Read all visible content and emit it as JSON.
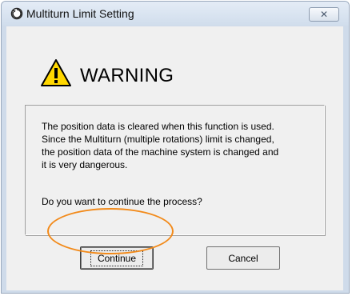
{
  "window": {
    "title": "Multiturn Limit Setting",
    "close_icon": "close-icon",
    "app_icon": "rotation-icon"
  },
  "dialog": {
    "warning_icon": "warning-triangle-icon",
    "warning_text": "WARNING",
    "message_lines": [
      "The position data is cleared when this function is used.",
      "Since the Multiturn (multiple rotations) limit is changed,",
      "the position data of the machine system is changed and",
      "it is very dangerous."
    ],
    "question": "Do you want to continue the process?",
    "continue_label": "Continue",
    "cancel_label": "Cancel"
  },
  "colors": {
    "highlight": "#f28a1a",
    "warning_fill": "#ffd700"
  }
}
